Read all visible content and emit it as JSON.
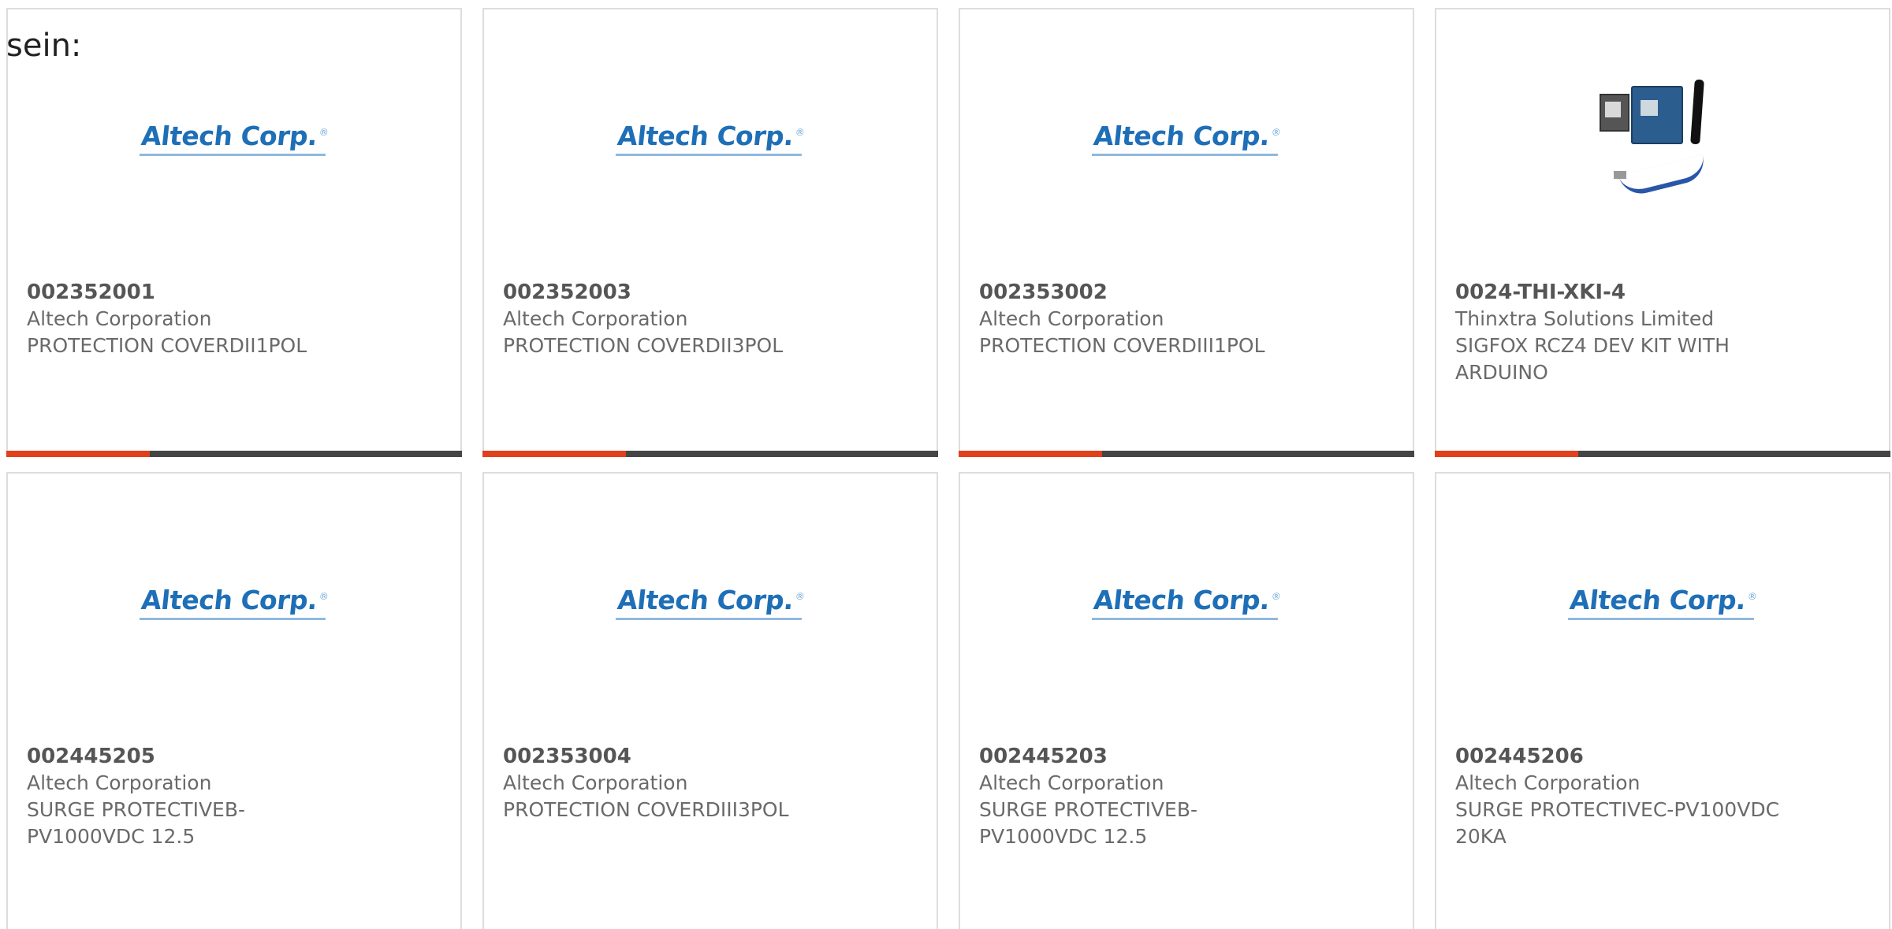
{
  "intro_text": "sein:",
  "logo": {
    "text": "Altech Corp.",
    "reg": "®"
  },
  "products": [
    {
      "part": "002352001",
      "maker": "Altech Corporation",
      "desc": "PROTECTION COVERDII1POL",
      "image": "altech-logo"
    },
    {
      "part": "002352003",
      "maker": "Altech Corporation",
      "desc": "PROTECTION COVERDII3POL",
      "image": "altech-logo"
    },
    {
      "part": "002353002",
      "maker": "Altech Corporation",
      "desc": "PROTECTION COVERDIII1POL",
      "image": "altech-logo"
    },
    {
      "part": "0024-THI-XKI-4",
      "maker": "Thinxtra Solutions Limited",
      "desc": "SIGFOX RCZ4 DEV KIT WITH\nARDUINO",
      "image": "dev-kit-photo"
    },
    {
      "part": "002445205",
      "maker": "Altech Corporation",
      "desc": "SURGE PROTECTIVEB-\nPV1000VDC 12.5",
      "image": "altech-logo"
    },
    {
      "part": "002353004",
      "maker": "Altech Corporation",
      "desc": "PROTECTION COVERDIII3POL",
      "image": "altech-logo"
    },
    {
      "part": "002445203",
      "maker": "Altech Corporation",
      "desc": "SURGE PROTECTIVEB-\nPV1000VDC 12.5",
      "image": "altech-logo"
    },
    {
      "part": "002445206",
      "maker": "Altech Corporation",
      "desc": "SURGE PROTECTIVEC-PV100VDC\n20KA",
      "image": "altech-logo"
    }
  ],
  "colors": {
    "accent": "#e0401c",
    "bar": "#454545",
    "logo_blue": "#1e6fb7",
    "text": "#6a6a6a"
  }
}
